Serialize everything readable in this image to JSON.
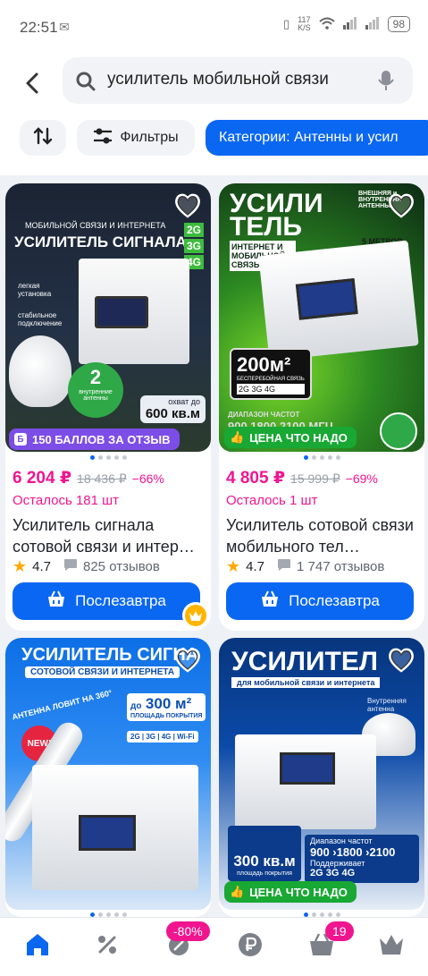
{
  "status": {
    "time": "22:51",
    "speed_value": "117",
    "speed_unit": "K/S",
    "battery": "98"
  },
  "search": {
    "query": "усилитель мобильной связи"
  },
  "chips": {
    "filters": "Фильтры",
    "category": "Категории: Антенны и усил"
  },
  "products": [
    {
      "price": "6 204 ₽",
      "old_price": "18 436 ₽",
      "discount": "−66%",
      "stock": "Осталось 181 шт",
      "title": "Усилитель сигнала сотовой связи и интер…",
      "rating": "4.7",
      "reviews": "825 отзывов",
      "badge": "150 БАЛЛОВ ЗА ОТЗЫВ",
      "buy": "Послезавтра",
      "image_text": {
        "top": "МОБИЛЬНОЙ СВЯЗИ И ИНТЕРНЕТА",
        "headline": "УСИЛИТЕЛЬ СИГНАЛА",
        "g2": "2G",
        "g3": "3G",
        "g4": "4G",
        "feat1": "легкая установка",
        "feat2": "стабильное подключение",
        "num": "2",
        "ant": "внутренние антенны",
        "cover1": "охват до",
        "cover2": "600 кв.м"
      }
    },
    {
      "price": "4 805 ₽",
      "old_price": "15 999 ₽",
      "discount": "−69%",
      "stock": "Осталось 1 шт",
      "title": "Усилитель сотовой связи мобильного тел…",
      "rating": "4.7",
      "reviews": "1 747 отзывов",
      "badge": "ЦЕНА ЧТО НАДО",
      "buy": "Послезавтра",
      "image_text": {
        "h1": "УСИЛИ",
        "h2": "ТЕЛЬ",
        "sub": "ИНТЕРНЕТ И МОБИЛЬНОЙ СВЯЗЬ",
        "area": "200м²",
        "area_sub": "БЕСПЕРЕБОЙНАЯ СВЯЗЬ",
        "bands": "2G 3G 4G",
        "cable": "5 МЕТРОВ КАБЕЛЯ",
        "ext": "ВНЕШНЯЯ и ВНУТРЕННЯЯ АНТЕННЫ",
        "range": "ДИАПАЗОН ЧАСТОТ",
        "freq": "900 1800 2100 МГЦ"
      }
    },
    {
      "image_text": {
        "headline": "УСИЛИТЕЛЬ СИГНА",
        "sub": "СОТОВОЙ СВЯЗИ И ИНТЕРНЕТА",
        "arc": "АНТЕННА ЛОВИТ НА 360°",
        "area_pre": "до",
        "area": "300 м²",
        "area_sub": "ПЛОЩАДЬ ПОКРЫТИЯ",
        "bands": "2G | 3G | 4G | Wi-Fi",
        "new": "NEW!"
      }
    },
    {
      "badge": "ЦЕНА ЧТО НАДО",
      "image_text": {
        "headline": "УСИЛИТЕЛ",
        "sub": "для мобильной связи и интернета",
        "inner": "Внутренняя антенна",
        "area": "300 кв.м",
        "area_sub": "площадь покрытия",
        "range": "Диапазон частот",
        "freq": "900 ›1800 ›2100",
        "supp": "Поддерживает",
        "bands": "2G 3G 4G"
      }
    }
  ],
  "nav": {
    "promo_badge": "-80%",
    "cart_count": "19"
  }
}
